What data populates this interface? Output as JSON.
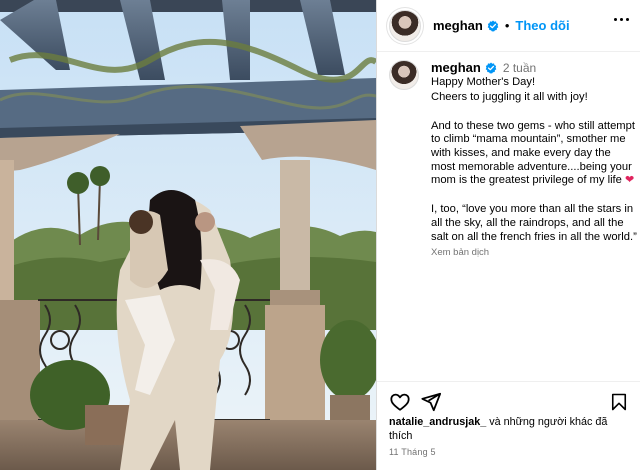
{
  "author": {
    "username": "meghan",
    "follow_label": "Theo dõi",
    "separator": "•"
  },
  "caption": {
    "username": "meghan",
    "time_ago": "2 tuần",
    "line1": "Happy Mother's Day!",
    "line2": "Cheers to juggling it all with joy!",
    "paragraph2": "And to these two gems - who still attempt to climb “mama mountain”, smother me with kisses, and make every day the most memorable adventure....being your mom is the greatest privilege of my life ",
    "heart": "❤",
    "paragraph3": "I, too, “love you more than all the stars in all the sky, all the raindrops, and all the salt on all the french fries in all the world.”",
    "translate_label": "Xem bản dịch"
  },
  "likes": {
    "user": "natalie_andrusjak_",
    "rest": " và những người khác đã thích"
  },
  "date": "11 Tháng 5",
  "icons": {
    "verified": "verified-badge-icon",
    "more": "more-options-icon",
    "like": "heart-outline-icon",
    "share": "send-icon",
    "save": "bookmark-icon"
  },
  "colors": {
    "accent": "#0095f6",
    "verified": "#0095f6",
    "muted": "#737373",
    "heart": "#e0245e"
  }
}
